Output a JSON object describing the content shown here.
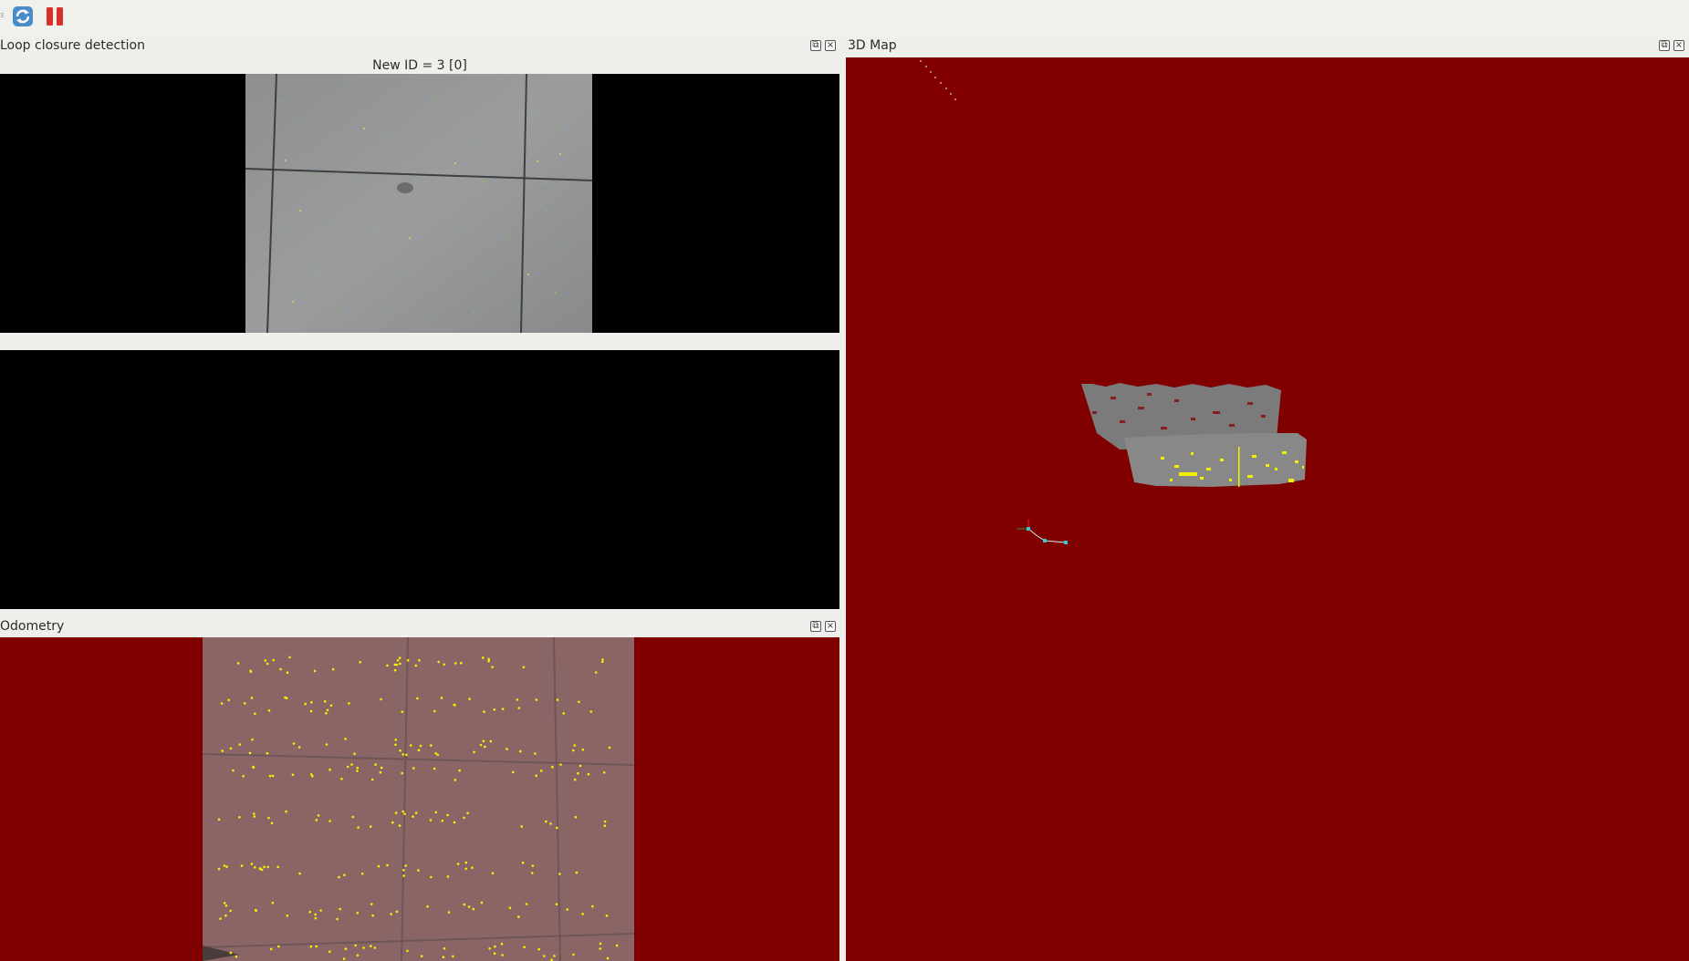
{
  "toolbar": {
    "buttons": [
      {
        "name": "refresh-icon",
        "tooltip": ""
      },
      {
        "name": "pause-icon",
        "tooltip": ""
      }
    ]
  },
  "loop_closure": {
    "title": "Loop closure detection",
    "new_id_label": "New ID = 3 [0]"
  },
  "odometry": {
    "title": "Odometry"
  },
  "map3d": {
    "title": "3D Map"
  },
  "colors": {
    "background_red": "#800000",
    "feature_yellow": "#f2f200",
    "window_bg": "#efefec"
  }
}
